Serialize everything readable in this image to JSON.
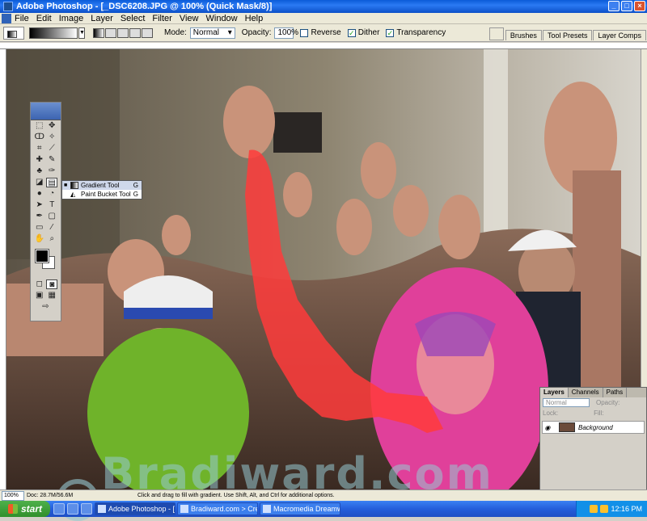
{
  "window": {
    "title": "Adobe Photoshop - [_DSC6208.JPG @ 100% (Quick Mask/8)]",
    "buttons": [
      "_",
      "□",
      "×"
    ]
  },
  "menu": [
    "File",
    "Edit",
    "Image",
    "Layer",
    "Select",
    "Filter",
    "View",
    "Window",
    "Help"
  ],
  "options": {
    "mode_label": "Mode:",
    "mode_value": "Normal",
    "opacity_label": "Opacity:",
    "opacity_value": "100%",
    "reverse_label": "Reverse",
    "reverse_checked": false,
    "dither_label": "Dither",
    "dither_checked": true,
    "transparency_label": "Transparency",
    "transparency_checked": true
  },
  "palette_well": [
    "Brushes",
    "Tool Presets",
    "Layer Comps"
  ],
  "tool_flyout": [
    {
      "label": "Gradient Tool",
      "key": "G",
      "selected": true
    },
    {
      "label": "Paint Bucket Tool",
      "key": "G",
      "selected": false
    }
  ],
  "toolbox_icons": [
    [
      "marquee-icon",
      "move-icon"
    ],
    [
      "lasso-icon",
      "magic-wand-icon"
    ],
    [
      "crop-icon",
      "slice-icon"
    ],
    [
      "healing-brush-icon",
      "brush-icon"
    ],
    [
      "clone-stamp-icon",
      "history-brush-icon"
    ],
    [
      "eraser-icon",
      "gradient-icon"
    ],
    [
      "blur-icon",
      "dodge-icon"
    ],
    [
      "path-selection-icon",
      "type-icon"
    ],
    [
      "pen-icon",
      "shape-icon"
    ],
    [
      "notes-icon",
      "eyedropper-icon"
    ],
    [
      "hand-icon",
      "zoom-icon"
    ]
  ],
  "layers_panel": {
    "tabs": [
      "Layers",
      "Channels",
      "Paths"
    ],
    "blend_mode": "Normal",
    "opacity_label": "Opacity:",
    "lock_label": "Lock:",
    "fill_label": "Fill:",
    "layer_name": "Background"
  },
  "status": {
    "zoom": "100%",
    "doc": "Doc: 28.7M/56.6M",
    "message": "Click and drag to fill with gradient. Use Shift, Alt, and Ctrl for additional options."
  },
  "watermark": "Bradiward.com",
  "taskbar": {
    "start": "start",
    "tasks": [
      "Adobe Photoshop - [...",
      "Bradiward.com > Cre...",
      "Macromedia Dreamw..."
    ],
    "clock": "12:16 PM"
  },
  "colors": {
    "foreground": "#000000",
    "background": "#ffffff",
    "quickmask": "#ff3b3b",
    "taskbar": "#245edb"
  }
}
